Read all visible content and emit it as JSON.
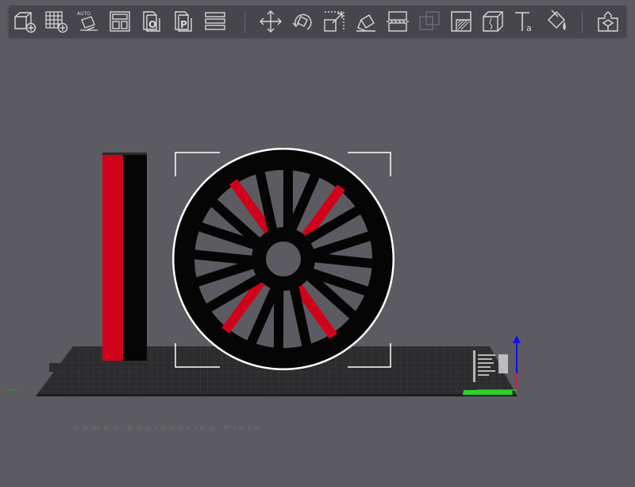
{
  "toolbar": {
    "auto_orient_label": "AUTO",
    "colors": {
      "icon": "#d8d8d8",
      "icon_accent": "#9a9a9a"
    },
    "items": [
      {
        "name": "add-object-button",
        "icon": "add-cube-icon"
      },
      {
        "name": "add-plate-button",
        "icon": "add-plate-grid-icon"
      },
      {
        "name": "auto-orient-button",
        "icon": "auto-orient-icon"
      },
      {
        "name": "arrange-button",
        "icon": "arrange-icon"
      },
      {
        "name": "split-objects-button",
        "icon": "split-objects-icon"
      },
      {
        "name": "split-parts-button",
        "icon": "split-parts-icon"
      },
      {
        "name": "layers-button",
        "icon": "layers-icon"
      },
      {
        "name": "move-tool-button",
        "icon": "move-arrows-icon"
      },
      {
        "name": "rotate-tool-button",
        "icon": "rotate-icon"
      },
      {
        "name": "scale-tool-button",
        "icon": "scale-icon"
      },
      {
        "name": "lay-on-face-button",
        "icon": "lay-on-face-icon"
      },
      {
        "name": "cut-tool-button",
        "icon": "cut-icon"
      },
      {
        "name": "boolean-tool-button",
        "icon": "boolean-icon"
      },
      {
        "name": "support-paint-button",
        "icon": "support-paint-icon"
      },
      {
        "name": "seam-paint-button",
        "icon": "seam-paint-icon"
      },
      {
        "name": "text-tool-button",
        "icon": "text-icon"
      },
      {
        "name": "color-paint-button",
        "icon": "paint-bucket-icon"
      },
      {
        "name": "assembly-view-button",
        "icon": "assembly-icon"
      }
    ]
  },
  "scene": {
    "plate_label": "Bambu Engineering Plate",
    "colors": {
      "background": "#5b5b61",
      "plate": "#2c2c2e",
      "grid": "#3d3d40",
      "object_black": "#050505",
      "object_red": "#d0021b",
      "selection": "#ffffff",
      "axis_x": "#ff2a2a",
      "axis_y": "#22cc22",
      "axis_z": "#1010ee"
    }
  }
}
